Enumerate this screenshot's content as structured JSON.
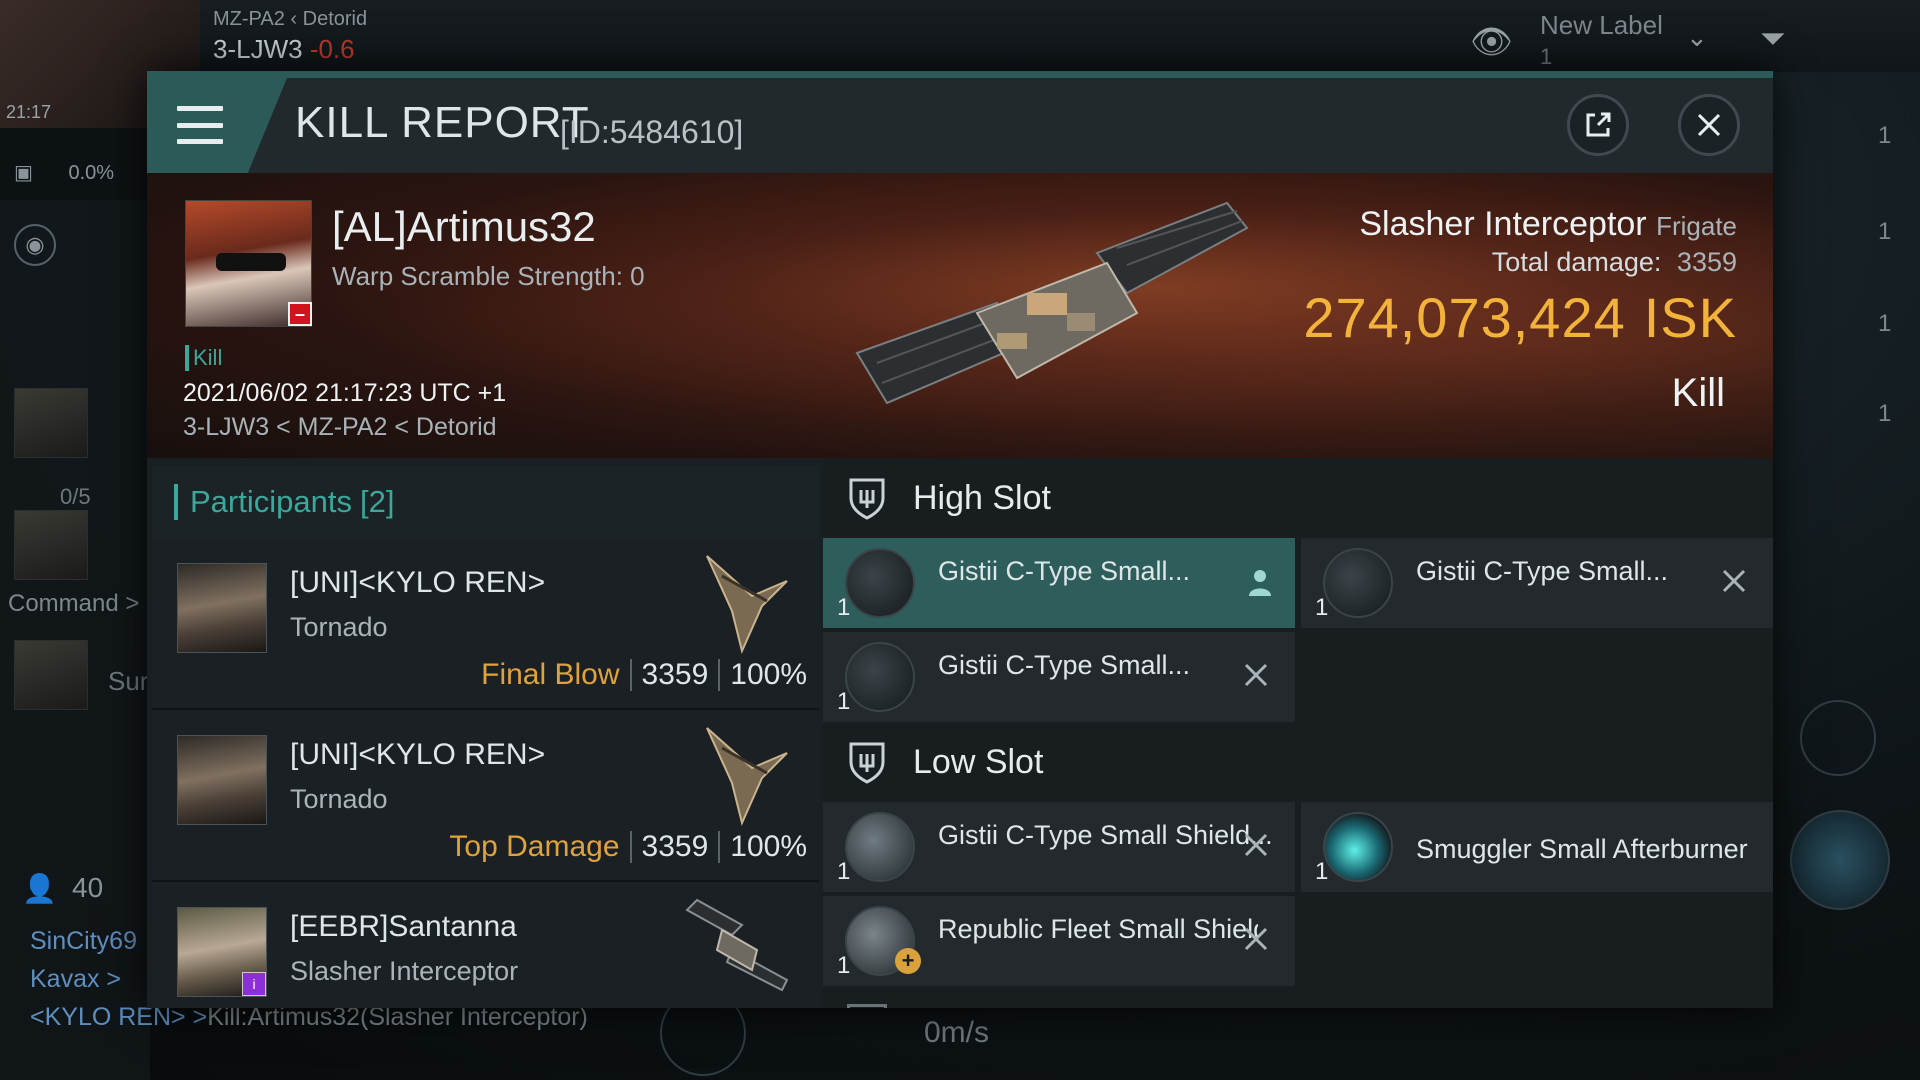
{
  "hud": {
    "location_top": "MZ-PA2",
    "location_parent": "Detorid",
    "system": "3-LJW3",
    "security": "-0.6",
    "time": "21:17",
    "cargo": "0.0%",
    "fleet_fraction": "0/5",
    "command_label": "Command >",
    "sur_fragment": "Sur",
    "local_count": "40",
    "new_label": "New Label",
    "new_label_count": "1",
    "right_counts": [
      "1",
      "1",
      "1",
      "1"
    ],
    "speed": "0m/s",
    "chat": [
      {
        "name": "SinCity69",
        "msg": ""
      },
      {
        "name": "Kavax >",
        "msg": ""
      },
      {
        "name": "<KYLO REN> >",
        "msg": "Kill:Artimus32(Slasher Interceptor)"
      }
    ]
  },
  "modal": {
    "title": "KILL REPORT",
    "report_id": "[ID:5484610]",
    "victim": {
      "name": "[AL]Artimus32",
      "warp_scramble": "Warp Scramble Strength: 0",
      "tag": "Kill",
      "datetime": "2021/06/02 21:17:23 UTC +1",
      "location": "3-LJW3 < MZ-PA2 < Detorid"
    },
    "ship": {
      "name": "Slasher Interceptor",
      "class": "Frigate",
      "total_damage_label": "Total damage:",
      "total_damage": "3359",
      "isk_value": "274,073,424",
      "isk_unit": "ISK",
      "result": "Kill"
    },
    "participants": {
      "title": "Participants",
      "count": "[2]",
      "rows": [
        {
          "name": "[UNI]<KYLO REN>",
          "ship": "Tornado",
          "role": "Final Blow",
          "damage": "3359",
          "percent": "100%"
        },
        {
          "name": "[UNI]<KYLO REN>",
          "ship": "Tornado",
          "role": "Top Damage",
          "damage": "3359",
          "percent": "100%"
        },
        {
          "name": "[EEBR]Santanna",
          "ship": "Slasher Interceptor",
          "role": "",
          "damage": "",
          "percent": ""
        }
      ]
    },
    "fittings": {
      "high_slot_title": "High Slot",
      "high_slot": [
        {
          "name": "Gistii C-Type Small...",
          "qty": "1"
        },
        {
          "name": "Gistii C-Type Small...",
          "qty": "1"
        },
        {
          "name": "Gistii C-Type Small...",
          "qty": "1"
        }
      ],
      "low_slot_title": "Low Slot",
      "low_slot": [
        {
          "name": "Gistii C-Type Small Shield...",
          "qty": "1"
        },
        {
          "name": "Smuggler Small Afterburner",
          "qty": "1"
        },
        {
          "name": "Republic Fleet Small Shield...",
          "qty": "1"
        }
      ]
    }
  }
}
